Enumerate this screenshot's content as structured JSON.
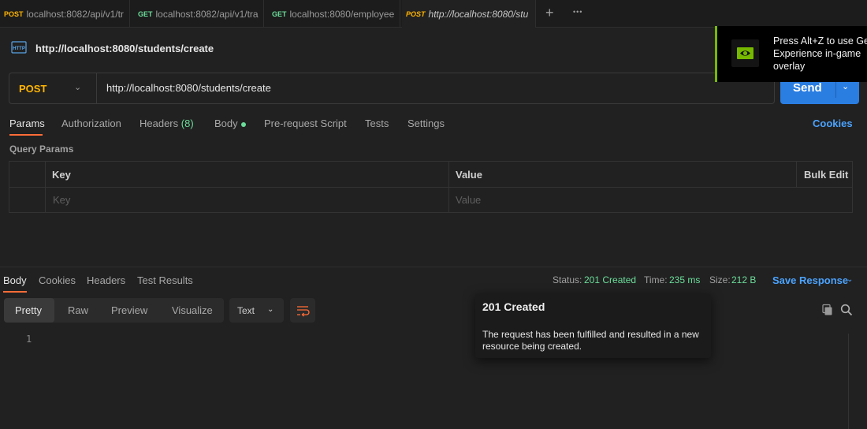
{
  "tabs": [
    {
      "method": "POST",
      "url": "localhost:8082/api/v1/tr"
    },
    {
      "method": "GET",
      "url": "localhost:8082/api/v1/tra"
    },
    {
      "method": "GET",
      "url": "localhost:8080/employee"
    },
    {
      "method": "POST",
      "url": "http://localhost:8080/stu"
    }
  ],
  "tabbar": {
    "new_tab": "+",
    "more": "•••"
  },
  "request": {
    "title": "http://localhost:8080/students/create",
    "method": "POST",
    "url": "http://localhost:8080/students/create",
    "send_label": "Send"
  },
  "request_tabs": {
    "params": "Params",
    "authorization": "Authorization",
    "headers": "Headers",
    "headers_count": "(8)",
    "body": "Body",
    "prerequest": "Pre-request Script",
    "tests": "Tests",
    "settings": "Settings",
    "cookies": "Cookies"
  },
  "query_params": {
    "title": "Query Params",
    "columns": {
      "key": "Key",
      "value": "Value",
      "bulk_edit": "Bulk Edit"
    },
    "placeholders": {
      "key": "Key",
      "value": "Value"
    }
  },
  "response": {
    "tabs": {
      "body": "Body",
      "cookies": "Cookies",
      "headers": "Headers",
      "test_results": "Test Results"
    },
    "status_label": "Status:",
    "status_value": "201 Created",
    "time_label": "Time:",
    "time_value": "235 ms",
    "size_label": "Size:",
    "size_value": "212 B",
    "save_label": "Save Response",
    "views": {
      "pretty": "Pretty",
      "raw": "Raw",
      "preview": "Preview",
      "visualize": "Visualize"
    },
    "format": "Text",
    "line_number": "1"
  },
  "tooltip": {
    "title": "201 Created",
    "text": "The request has been fulfilled and resulted in a new resource being created."
  },
  "overlay": {
    "text_line1": "Press Alt+Z to use Ge",
    "text_line2": "Experience in-game",
    "text_line3": "overlay"
  },
  "colors": {
    "accent": "#ff6c37",
    "send": "#2a7de1",
    "post": "#ffb400",
    "get": "#6bdd9a",
    "nvidia": "#76b900"
  }
}
